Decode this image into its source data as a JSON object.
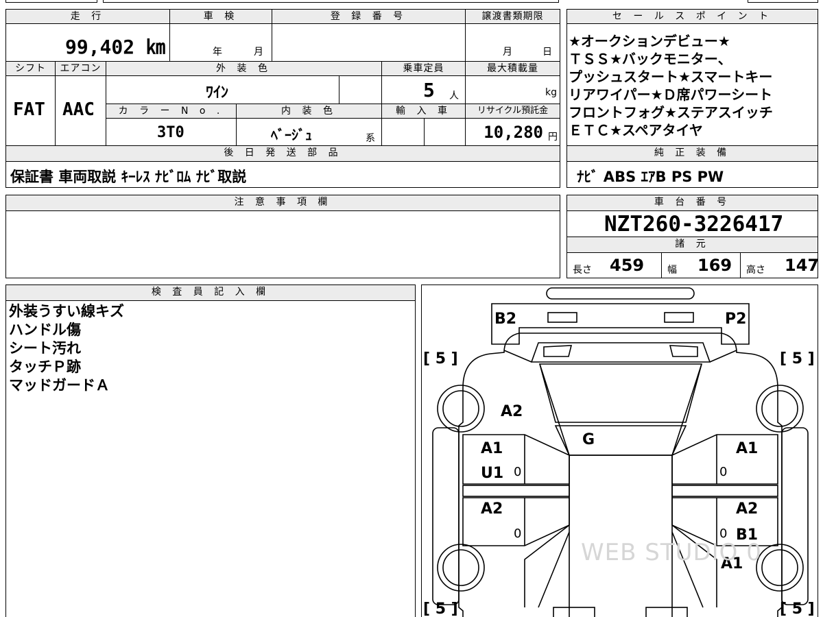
{
  "header": {
    "mileage_label": "走 行",
    "inspection_label": "車 検",
    "registration_label": "登 録 番 号",
    "transfer_deadline_label": "譲渡書類期限",
    "sales_points_label": "セ ー ル ス ポ イ ン ト"
  },
  "values": {
    "mileage": "99,402 ㎞",
    "inspection_year": "年",
    "inspection_month": "月",
    "deadline_month": "月",
    "deadline_day": "日"
  },
  "row2": {
    "shift_label": "シフト",
    "aircon_label": "エアコン",
    "exterior_color_label": "外 装 色",
    "capacity_label": "乗車定員",
    "max_load_label": "最大積載量",
    "shift": "FAT",
    "aircon": "AAC",
    "exterior_color": "ﾜｲﾝ",
    "capacity": "5",
    "capacity_unit": "人",
    "load_unit": "kg"
  },
  "row3": {
    "color_no_label": "カ ラ ー N o .",
    "interior_color_label": "内 装 色",
    "import_label": "輸 入 車",
    "recycle_label": "リサイクル預託金",
    "color_no": "3T0",
    "interior_color": "ﾍﾞｰｼﾞｭ",
    "interior_suffix": "系",
    "recycle_fee": "10,280",
    "recycle_unit": "円"
  },
  "sales_points": [
    "★オークションデビュー★",
    "ＴＳＳ★バックモニター、",
    "プッシュスタート★スマートキー",
    "リアワイパー★Ｄ席パワーシート",
    "フロントフォグ★ステアスイッチ",
    "ＥＴＣ★スペアタイヤ"
  ],
  "later_parts": {
    "label": "後 日 発 送 部 品",
    "value": "保証書 車両取説 ｷｰﾚｽ ﾅﾋﾞﾛﾑ ﾅﾋﾞ取説"
  },
  "genuine_equipment": {
    "label": "純 正 装 備",
    "value": "ﾅﾋﾞ ABS ｴｱB PS PW"
  },
  "notes": {
    "label": "注 意 事 項 欄"
  },
  "chassis": {
    "label": "車 台 番 号",
    "value": "NZT260-3226417"
  },
  "specs": {
    "label": "諸 元",
    "length_label": "長さ",
    "length": "459",
    "width_label": "幅",
    "width": "169",
    "height_label": "高さ",
    "height": "147"
  },
  "inspector": {
    "label": "検 査 員 記 入 欄",
    "lines": [
      "外装うすい線キズ",
      "ハンドル傷",
      "シート汚れ",
      "タッチＰ跡",
      "マッドガードＡ"
    ]
  },
  "diagram": {
    "tire_marks": [
      "[ 5 ]",
      "[ 5 ]",
      "[ 5 ]",
      "[ 5 ]"
    ],
    "codes": {
      "rear_left": "B2",
      "rear_right": "P2",
      "roof_left": "A2",
      "roof_center": "G",
      "rear_door_left_1": "A1",
      "rear_door_left_2": "U1",
      "rear_door_right": "A1",
      "front_door_left": "A2",
      "front_door_right_1": "A2",
      "front_door_right_2": "B1",
      "front_fender_right": "A1"
    },
    "zero_marks": [
      "0",
      "0",
      "0",
      "0"
    ],
    "watermark": "WEB STUDIO 0"
  }
}
